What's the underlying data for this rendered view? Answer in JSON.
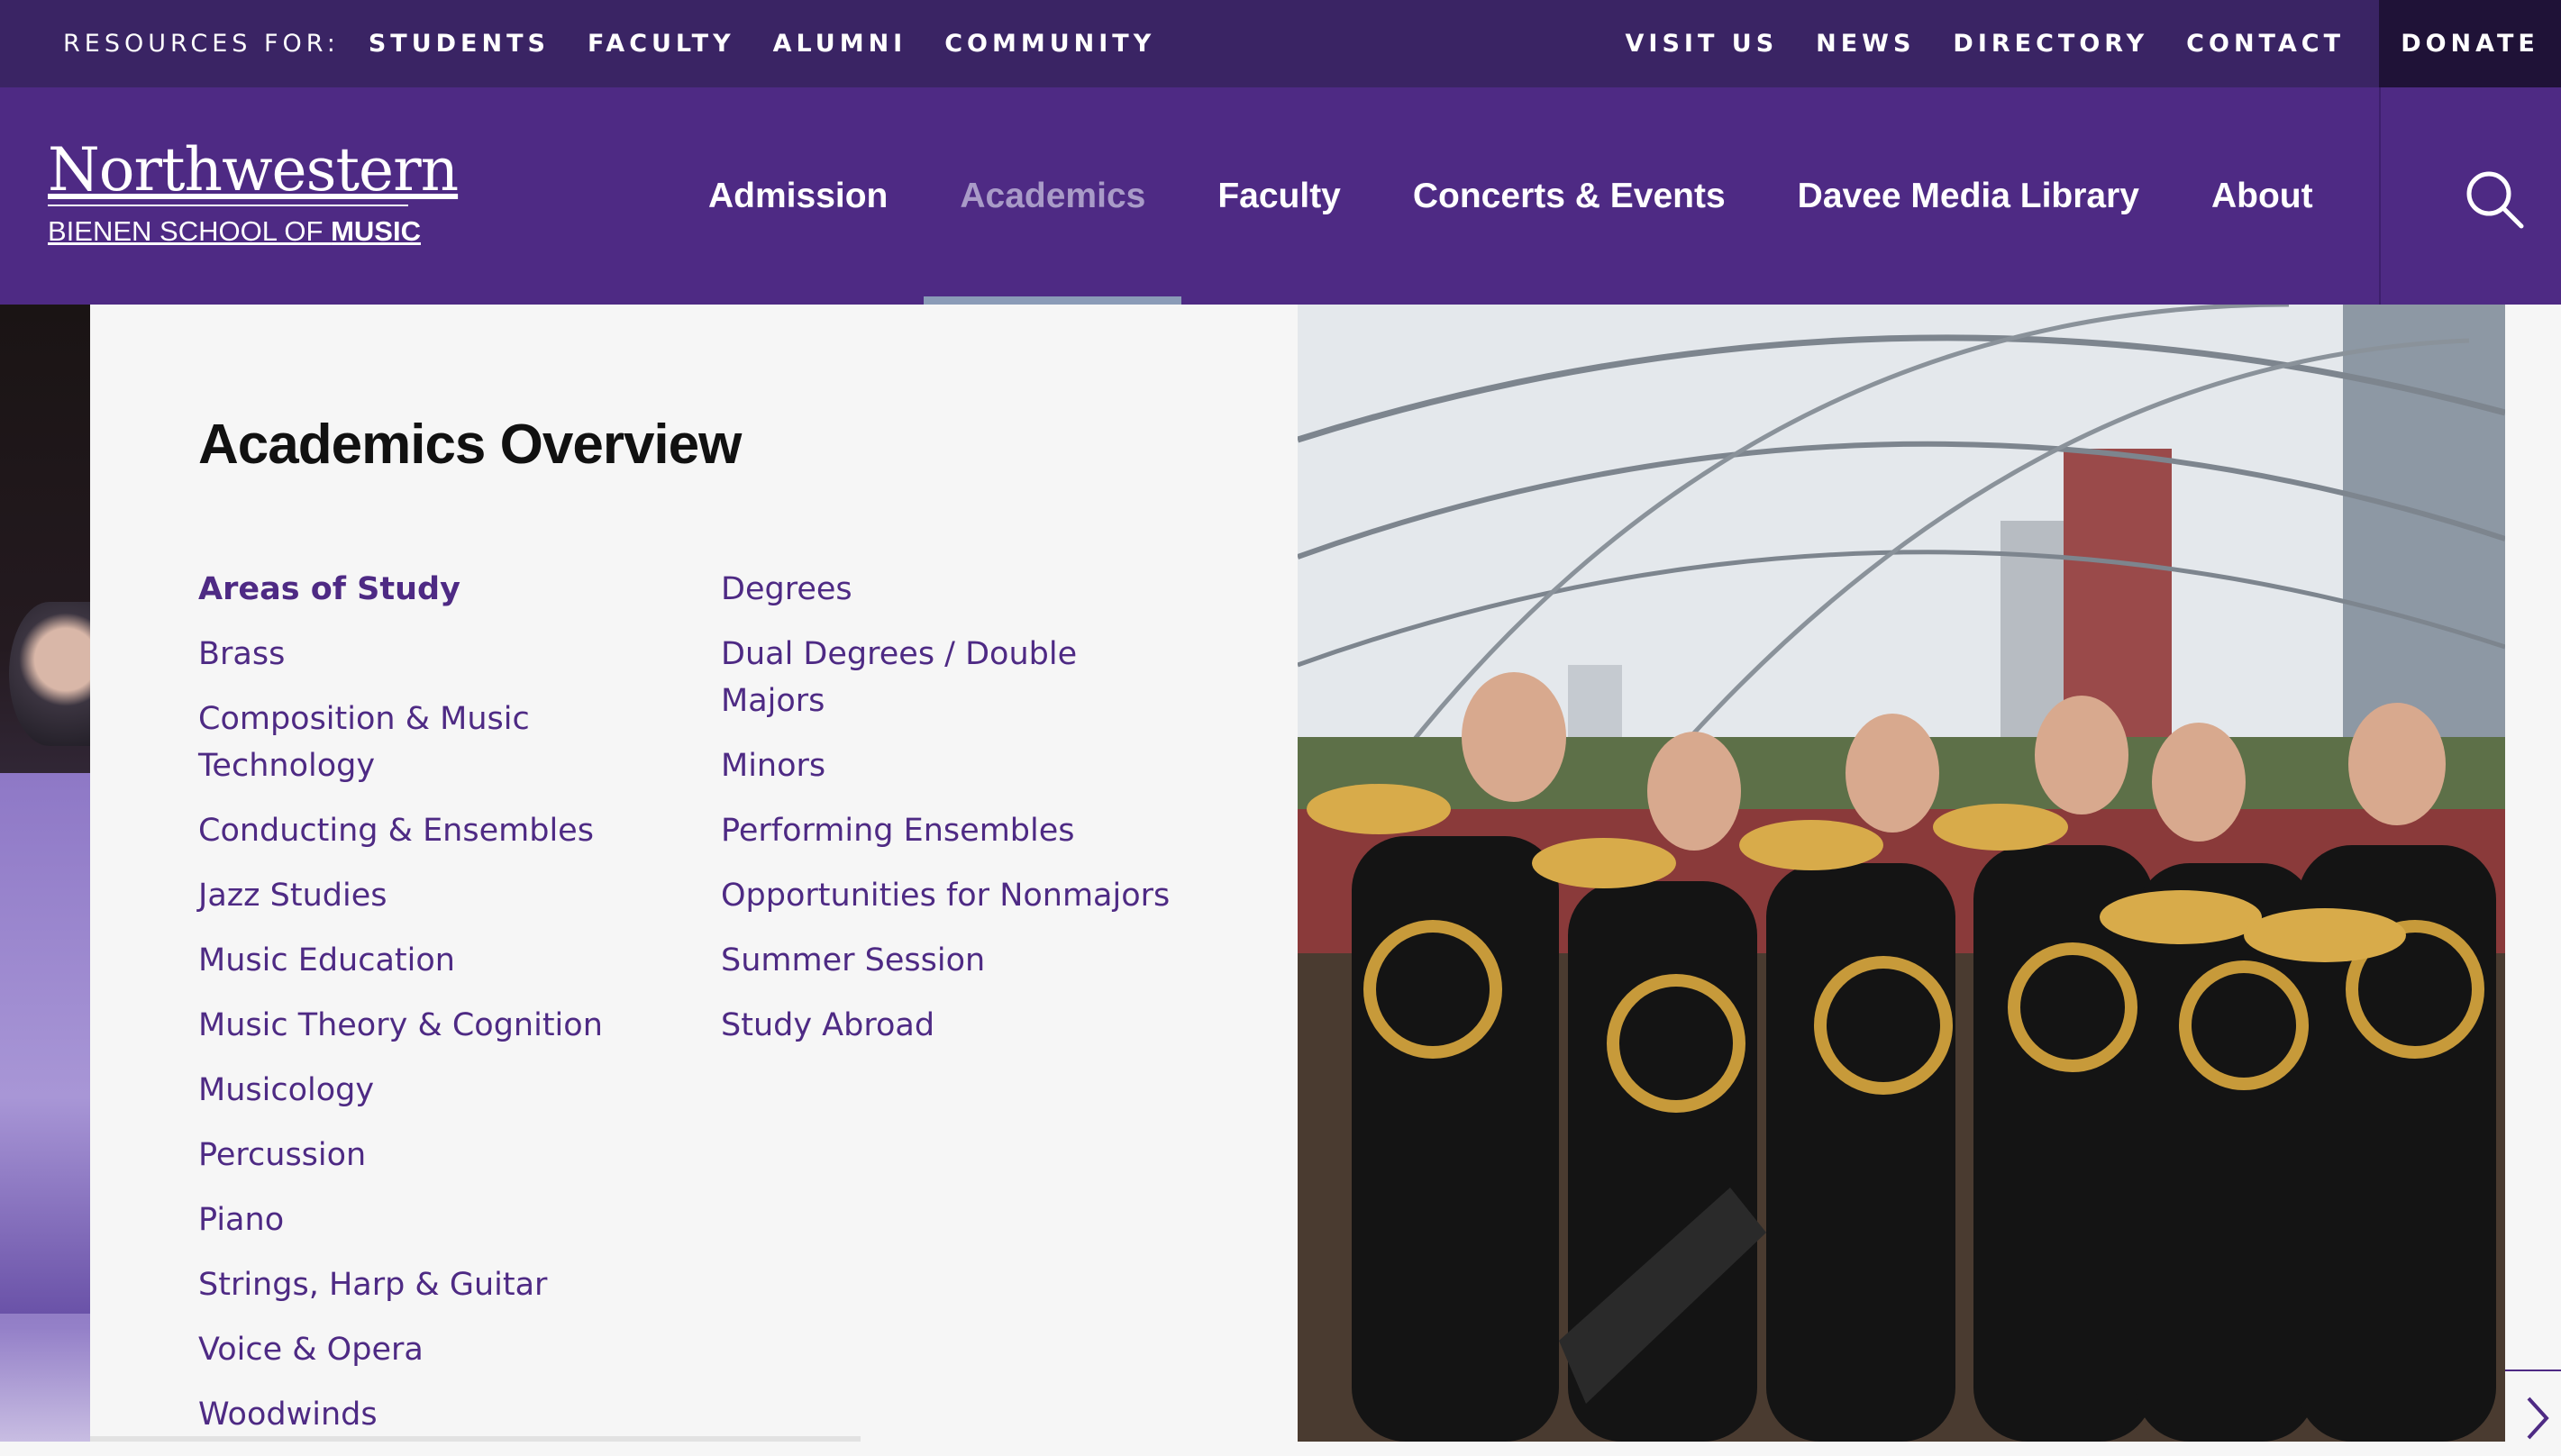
{
  "utility": {
    "resources_label": "RESOURCES FOR:",
    "resources": [
      "STUDENTS",
      "FACULTY",
      "ALUMNI",
      "COMMUNITY"
    ],
    "links": [
      "VISIT US",
      "NEWS",
      "DIRECTORY",
      "CONTACT"
    ],
    "donate": "DONATE"
  },
  "logo": {
    "wordmark": "Northwestern",
    "sub_regular": "BIENEN SCHOOL OF ",
    "sub_bold": "MUSIC"
  },
  "nav": {
    "items": [
      "Admission",
      "Academics",
      "Faculty",
      "Concerts & Events",
      "Davee Media Library",
      "About"
    ],
    "active": "Academics",
    "search_icon": "search-icon"
  },
  "mega": {
    "title": "Academics Overview",
    "left_column": [
      "Areas of Study",
      "Brass",
      "Composition & Music Technology",
      "Conducting & Ensembles",
      "Jazz Studies",
      "Music Education",
      "Music Theory & Cognition",
      "Musicology",
      "Percussion",
      "Piano",
      "Strings, Harp & Guitar",
      "Voice & Opera",
      "Woodwinds"
    ],
    "right_column": [
      "Degrees",
      "Dual Degrees / Double Majors",
      "Minors",
      "Performing Ensembles",
      "Opportunities for Nonmajors",
      "Summer Session",
      "Study Abroad"
    ]
  },
  "colors": {
    "purple": "#4e2a84",
    "dark_purple": "#3a2464",
    "donate_bg": "#1f1237"
  }
}
